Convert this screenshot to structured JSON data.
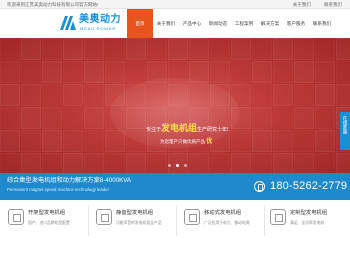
{
  "topbar": {
    "welcome": "欢迎来到江苏美奥动力科技有限公司官方网站!",
    "links": [
      "关于我们",
      "联系我们"
    ]
  },
  "logo": {
    "cn": "美奥动力",
    "en": "MEAO POWER",
    "color": "#1b8fd6"
  },
  "nav": [
    {
      "label": "首页",
      "active": true
    },
    {
      "label": "关于我们"
    },
    {
      "label": "产品中心"
    },
    {
      "label": "新闻动态"
    },
    {
      "label": "工程案例"
    },
    {
      "label": "解决方案"
    },
    {
      "label": "客户服务"
    },
    {
      "label": "联系我们"
    }
  ],
  "banner": {
    "slogan_prefix": "专注于",
    "slogan_highlight": "发电机组",
    "slogan_suffix": "生产研究十年!",
    "subline_prefix": "为您量产只做优质产品",
    "subline_em": "优",
    "dots": 3,
    "active_dot": 1,
    "bg_color": "#b93333"
  },
  "float_tab": {
    "label": "在线客服"
  },
  "strip": {
    "title": "综合集型发电机组和动力解决方案8-4000KVA",
    "subtitle": "Permanent magnet speed machine technology leader",
    "phone": "180-5262-2779",
    "color": "#1f89cd"
  },
  "services": [
    {
      "icon": "generator-icon",
      "title": "开架型发电机组",
      "desc": "国产、进口品牌机型配置"
    },
    {
      "icon": "silent-icon",
      "title": "静音型发电机组",
      "desc": "功能声音的发电机组全产品"
    },
    {
      "icon": "mobile-icon",
      "title": "移动式发电机组",
      "desc": "广泛应用于电力、移动电源"
    },
    {
      "icon": "custom-icon",
      "title": "定制型发电机组",
      "desc": "满足、全功率发电机"
    }
  ],
  "accent_color": "#e8541d"
}
